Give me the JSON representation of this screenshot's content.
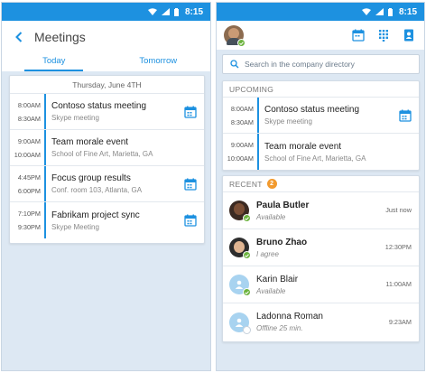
{
  "status_bar": {
    "time": "8:15"
  },
  "left_screen": {
    "title": "Meetings",
    "tabs": [
      {
        "label": "Today",
        "active": true
      },
      {
        "label": "Tomorrow",
        "active": false
      }
    ],
    "date_header": "Thursday, June 4TH",
    "meetings": [
      {
        "start": "8:00AM",
        "end": "8:30AM",
        "title": "Contoso status meeting",
        "subtitle": "Skype meeting",
        "icon": "calendar-join-icon"
      },
      {
        "start": "9:00AM",
        "end": "10:00AM",
        "title": "Team morale event",
        "subtitle": "School of Fine Art, Marietta, GA",
        "icon": null
      },
      {
        "start": "4:45PM",
        "end": "6:00PM",
        "title": "Focus group results",
        "subtitle": "Conf. room 103, Atlanta, GA",
        "icon": "calendar-join-icon"
      },
      {
        "start": "7:10PM",
        "end": "9:30PM",
        "title": "Fabrikam project sync",
        "subtitle": "Skype Meeting",
        "icon": "calendar-join-icon"
      }
    ]
  },
  "right_screen": {
    "search_placeholder": "Search in the company directory",
    "upcoming_label": "UPCOMING",
    "upcoming": [
      {
        "start": "8:00AM",
        "end": "8:30AM",
        "title": "Contoso status meeting",
        "subtitle": "Skype meeting",
        "icon": "calendar-join-icon"
      },
      {
        "start": "9:00AM",
        "end": "10:00AM",
        "title": "Team morale event",
        "subtitle": "School of Fine Art, Marietta, GA",
        "icon": null
      }
    ],
    "recent_label": "RECENT",
    "recent_count": "2",
    "recent": [
      {
        "name": "Paula Butler",
        "status": "Available",
        "time": "Just now",
        "bold": true,
        "avatar": "photo",
        "presence": "available"
      },
      {
        "name": "Bruno Zhao",
        "status": "I agree",
        "time": "12:30PM",
        "bold": true,
        "avatar": "photo",
        "presence": "available"
      },
      {
        "name": "Karin Blair",
        "status": "Available",
        "time": "11:00AM",
        "bold": false,
        "avatar": "generic",
        "presence": "available"
      },
      {
        "name": "Ladonna Roman",
        "status": "Offline 25 min.",
        "time": "9:23AM",
        "bold": false,
        "avatar": "generic",
        "presence": "offline"
      }
    ]
  },
  "colors": {
    "accent": "#1d91e0",
    "status_bar": "#1d91e0",
    "background": "#dde8f3",
    "presence_available": "#6cb33e",
    "badge": "#f29a2e"
  }
}
